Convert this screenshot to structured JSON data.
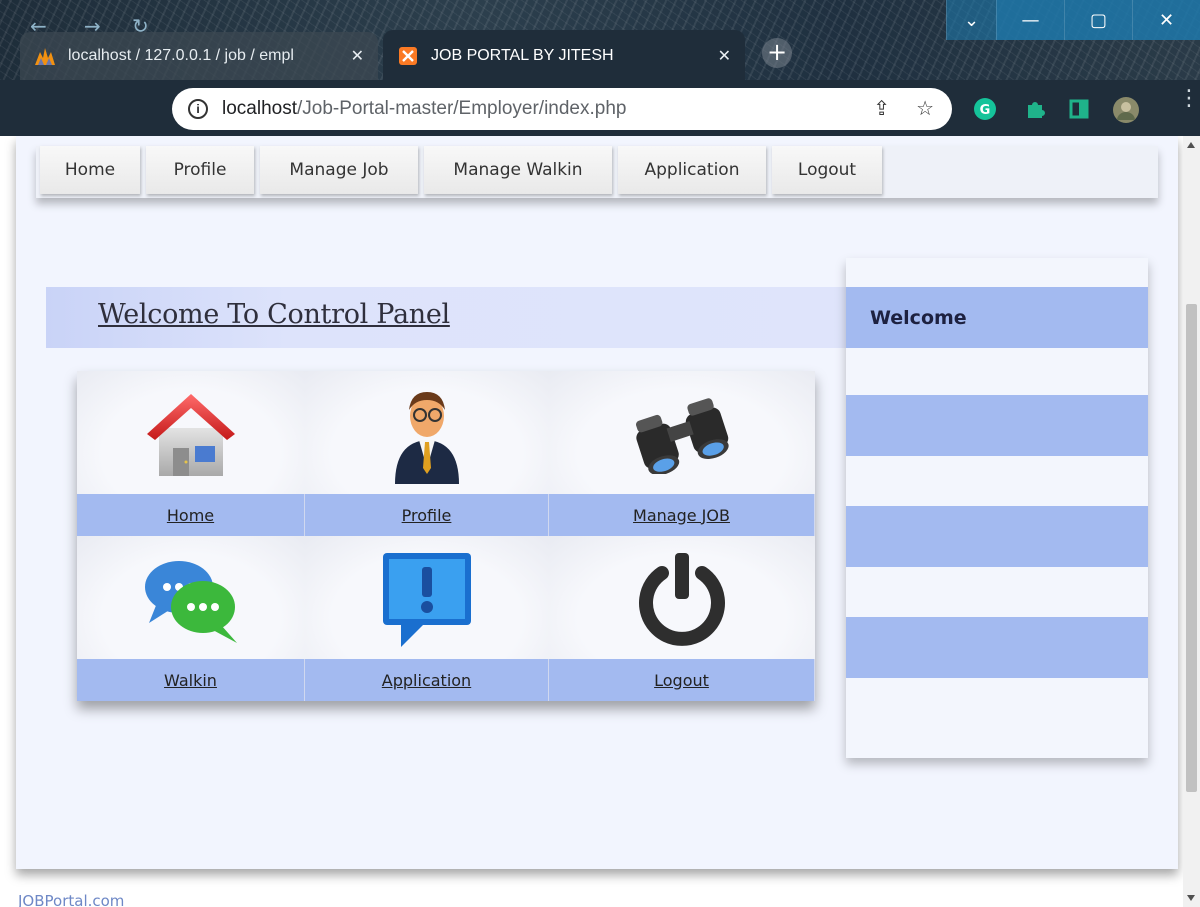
{
  "browser": {
    "tabs": [
      {
        "title": "localhost / 127.0.0.1 / job / empl",
        "favicon": "phpmyadmin-icon",
        "active": false
      },
      {
        "title": "JOB PORTAL BY JITESH",
        "favicon": "xampp-icon",
        "active": true
      }
    ],
    "url_host": "localhost",
    "url_path": "/Job-Portal-master/Employer/index.php",
    "window_controls": [
      "chevron-down-icon",
      "minimize-icon",
      "maximize-icon",
      "close-icon"
    ]
  },
  "topnav": {
    "items": [
      {
        "label": "Home"
      },
      {
        "label": "Profile"
      },
      {
        "label": "Manage Job"
      },
      {
        "label": "Manage Walkin"
      },
      {
        "label": "Application"
      },
      {
        "label": "Logout"
      }
    ]
  },
  "main": {
    "welcome_title": "Welcome To Control Panel",
    "tiles": [
      {
        "label": "Home",
        "icon": "home-icon"
      },
      {
        "label": "Profile",
        "icon": "person-icon"
      },
      {
        "label": "Manage JOB",
        "icon": "binoculars-icon"
      },
      {
        "label": "Walkin",
        "icon": "chat-bubbles-icon"
      },
      {
        "label": "Application",
        "icon": "alert-bubble-icon"
      },
      {
        "label": "Logout",
        "icon": "power-icon"
      }
    ]
  },
  "sidebar": {
    "items": [
      {
        "label": "Welcome"
      },
      {
        "label": ""
      },
      {
        "label": ""
      },
      {
        "label": ""
      }
    ]
  },
  "footer": {
    "text": "JOBPortal.com"
  },
  "colors": {
    "accent": "#a3baf0",
    "page_bg": "#f2f5fe",
    "welcome_band": "#dfe4fb"
  }
}
